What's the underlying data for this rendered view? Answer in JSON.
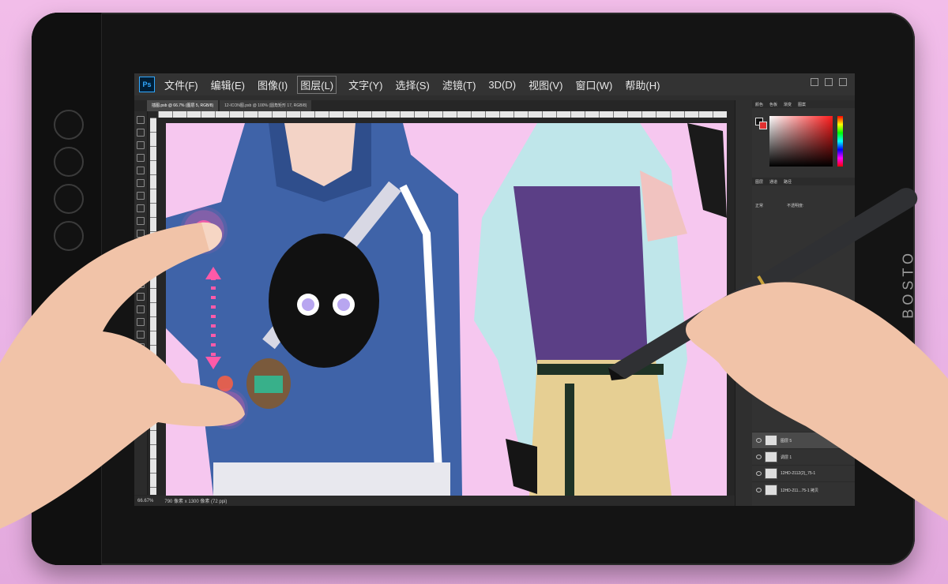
{
  "device": {
    "brand": "BOSTO"
  },
  "app": {
    "logo": "Ps",
    "menu": [
      "文件(F)",
      "编辑(E)",
      "图像(I)",
      "图层(L)",
      "文字(Y)",
      "选择(S)",
      "滤镜(T)",
      "3D(D)",
      "视图(V)",
      "窗口(W)",
      "帮助(H)"
    ],
    "active_menu": "图层(L)"
  },
  "document_tabs": [
    "插图.psb @ 66.7% (图层 5, RGB/8)",
    "12-ICON图.psb @ 100% (圆角矩形 17, RGB/8)"
  ],
  "status": {
    "zoom": "66.67%",
    "doc_info": "790 像素 x 1300 像素 (72 ppi)"
  },
  "panels": {
    "color_tabs": [
      "颜色",
      "色板",
      "渐变",
      "图案"
    ],
    "layers_tabs": [
      "图层",
      "通道",
      "路径"
    ],
    "blend_mode": "正常",
    "opacity_label": "不透明度:",
    "layers": [
      "图层 5",
      "调层 1",
      "12HD-2112(2)_75-1",
      "12HD-211...75-1 拷贝"
    ]
  },
  "colors": {
    "accent_touch": "#ff5aa8",
    "canvas_bg": "#f6c7ef",
    "hoodie": "#3f63a8",
    "tank": "#5b3f86",
    "hair": "#bfe6ea",
    "pants": "#e6cf93"
  }
}
